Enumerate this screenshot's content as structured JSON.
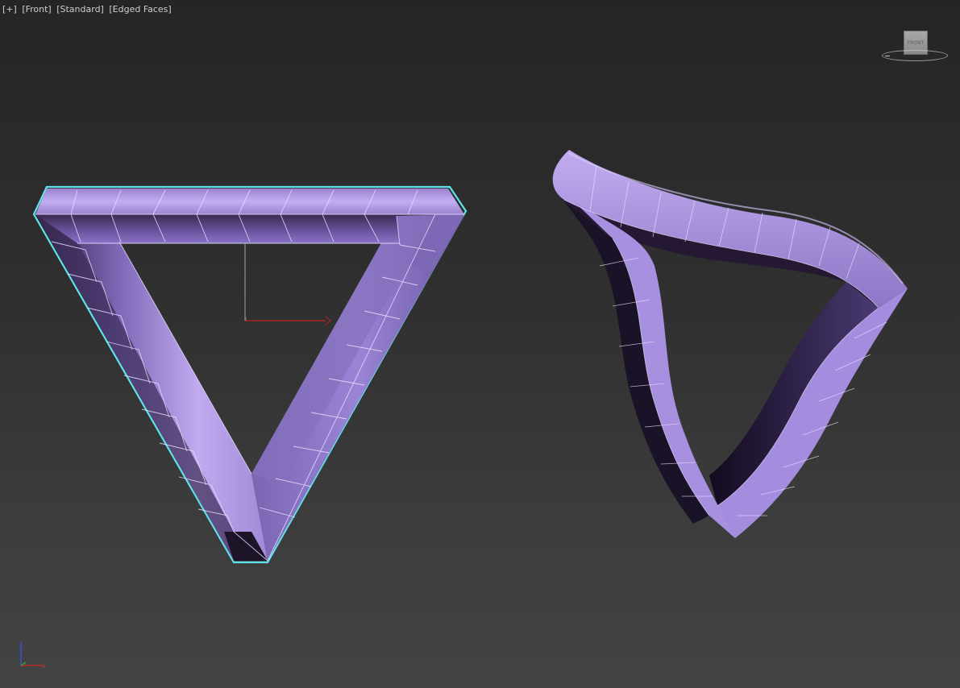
{
  "viewport": {
    "labels": {
      "menu": "[+]",
      "point_of_view": "[Front]",
      "shading_mode": "[Standard]",
      "display_mode": "[Edged Faces]"
    },
    "viewcube": {
      "face_label": "FRONT"
    },
    "gizmo": {
      "axis_label": "z"
    },
    "tripod": {
      "z_label": "z",
      "x_label": "x"
    },
    "colors": {
      "object_fill": "#a98fe0",
      "object_shadow": "#2a1e3c",
      "selection_outline": "#5fe3ea",
      "gizmo_x": "#c02020",
      "gizmo_z": "#a0a0a0",
      "tripod_z": "#3a55ff",
      "tripod_x": "#d02828",
      "tripod_y": "#30b030"
    },
    "objects": [
      {
        "name": "penrose-triangle",
        "selected": true
      },
      {
        "name": "twisted-triangle",
        "selected": false
      }
    ]
  }
}
